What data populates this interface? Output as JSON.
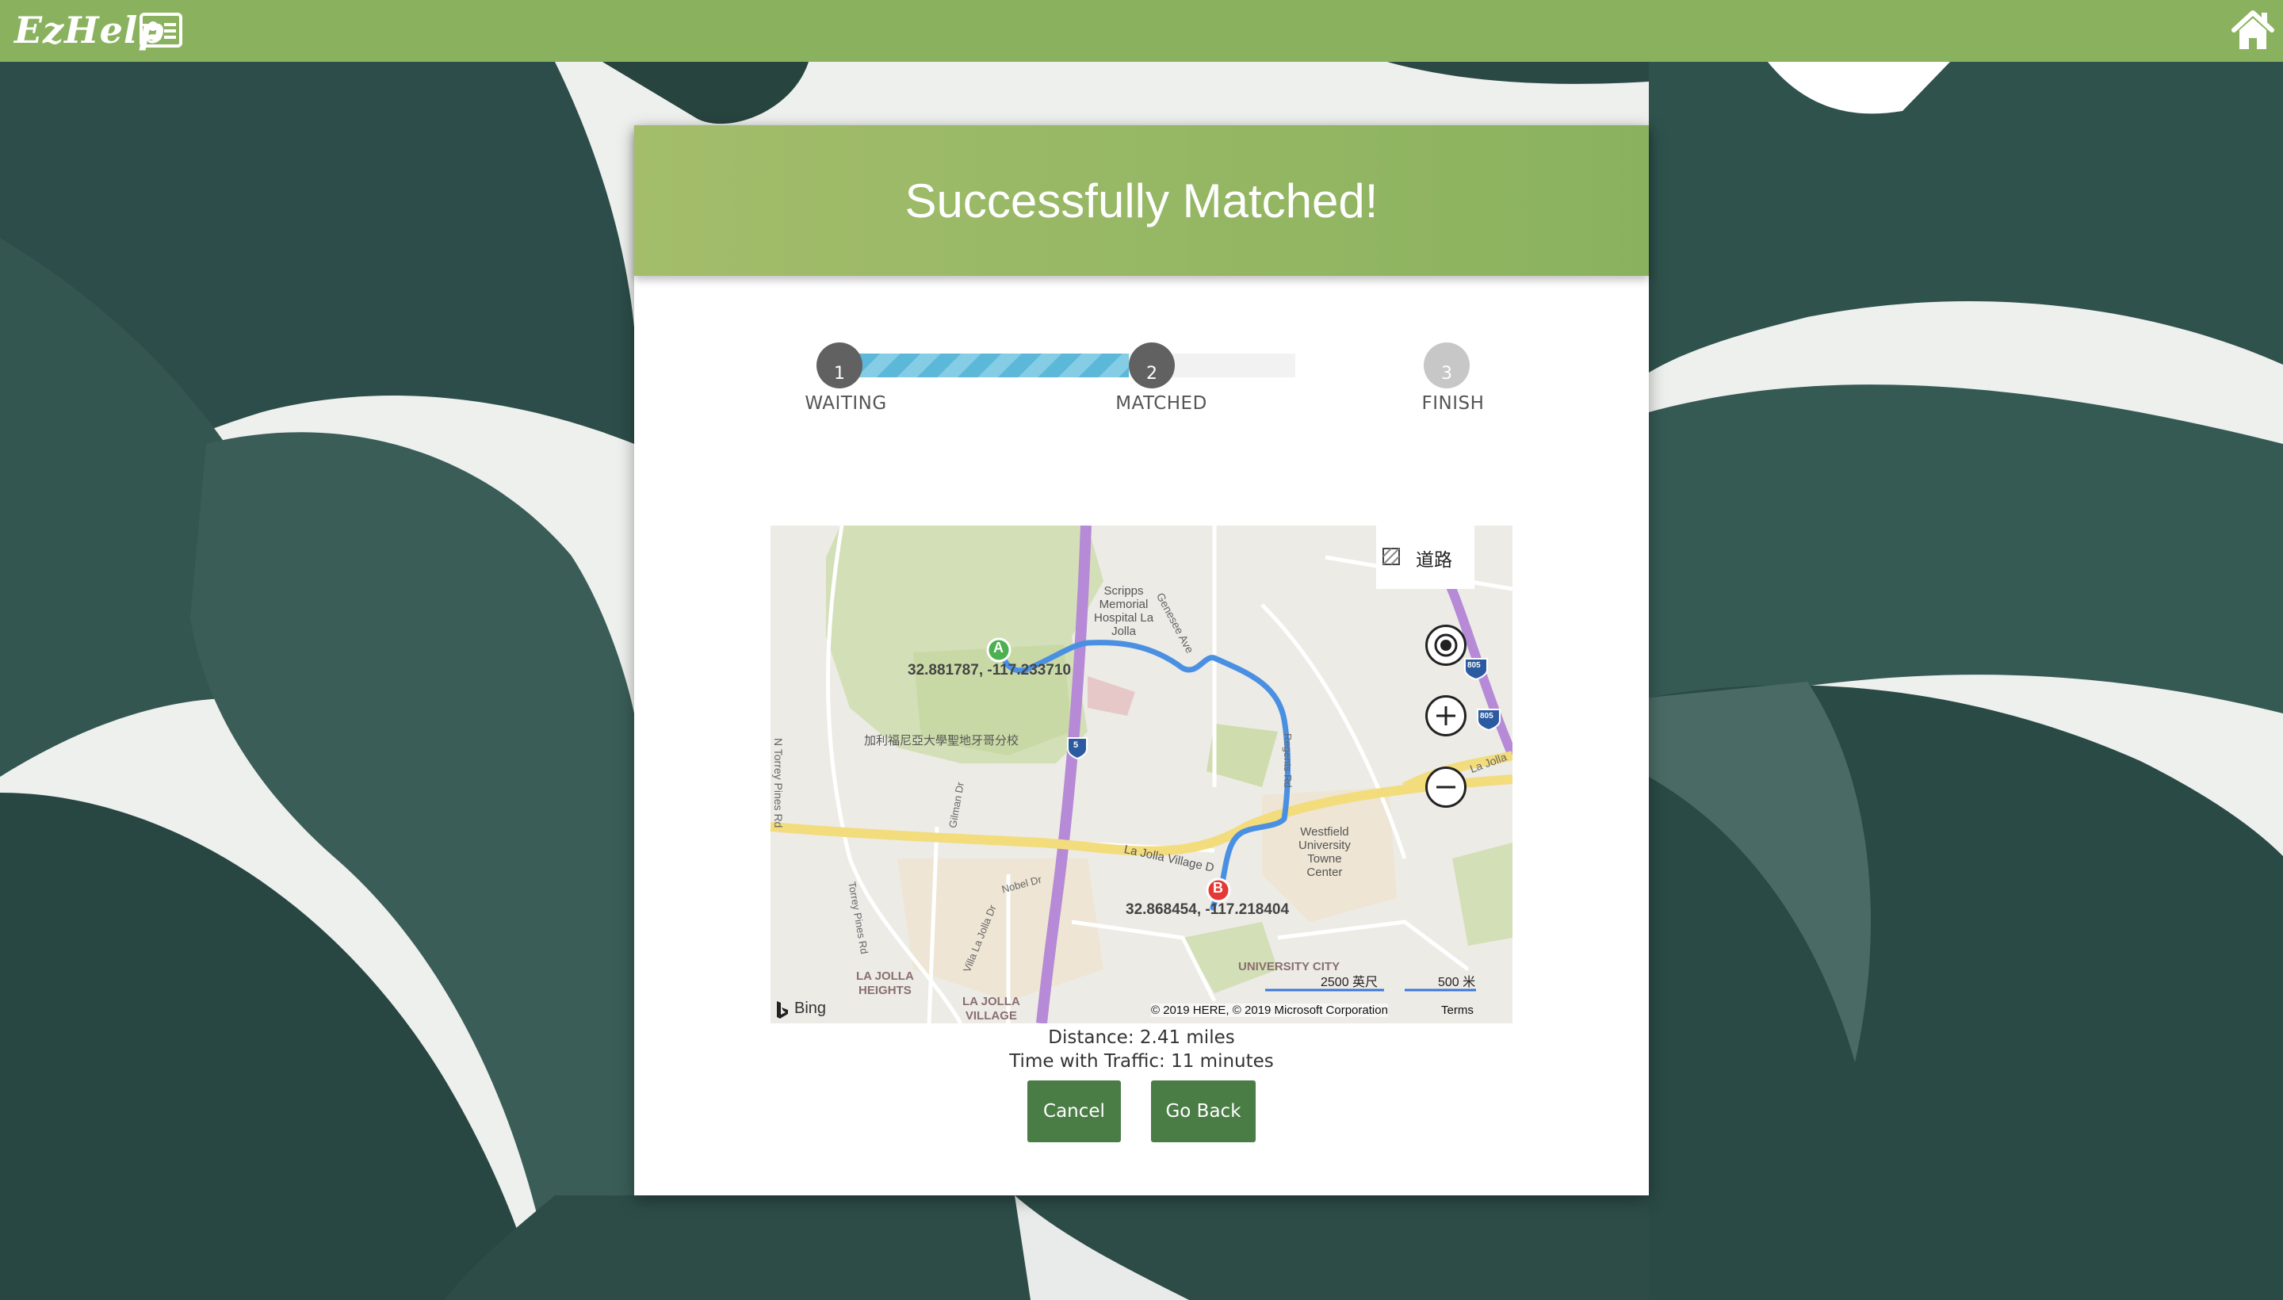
{
  "app": {
    "name": "EzHelp"
  },
  "header": {
    "title": "Successfully Matched!"
  },
  "progress": {
    "fraction": 0.5,
    "steps": [
      {
        "number": "1",
        "label": "WAITING",
        "state": "done"
      },
      {
        "number": "2",
        "label": "MATCHED",
        "state": "current"
      },
      {
        "number": "3",
        "label": "FINISH",
        "state": "pending"
      }
    ]
  },
  "map": {
    "style_label": "道路",
    "origin": {
      "marker": "A",
      "coords": "32.881787, -117.233710"
    },
    "destination": {
      "marker": "B",
      "coords": "32.868454, -117.218404"
    },
    "labels": {
      "hospital": [
        "Scripps",
        "Memorial",
        "Hospital La",
        "Jolla"
      ],
      "campus": "加利福尼亞大學聖地牙哥分校",
      "torrey": "N Torrey Pines Rd",
      "genesee": "Genesee Ave",
      "regents": "Regents Rd",
      "lajolla_village": "La Jolla Village D",
      "westfield": [
        "Westfield",
        "University",
        "Towne",
        "Center"
      ],
      "gilman": "Gilman Dr",
      "nobel": "Nobel Dr",
      "villa": "Villa La Jolla Dr",
      "torrey2": "Torrey Pines Rd",
      "lj_heights": [
        "LA JOLLA",
        "HEIGHTS"
      ],
      "lj_village": [
        "LA JOLLA",
        "VILLAGE"
      ],
      "university_city": "UNIVERSITY CITY",
      "lajolla_right": "La Jolla",
      "i5": "5",
      "i805a": "805",
      "i805b": "805"
    },
    "scale_feet": "2500 英尺",
    "scale_meters": "500 米",
    "brand": "Bing",
    "copyright": "© 2019 HERE, © 2019 Microsoft Corporation",
    "terms": "Terms"
  },
  "trip": {
    "distance": "Distance: 2.41 miles",
    "time": "Time with Traffic: 11 minutes"
  },
  "buttons": {
    "cancel": "Cancel",
    "go_back": "Go Back"
  },
  "colors": {
    "topbar": "#8ab25e",
    "header_left": "#a3bd6b",
    "button": "#4a7d45",
    "route": "#4a90e2",
    "progress": "#5cb8d8"
  },
  "icons": [
    "id-card-icon",
    "home-icon",
    "locate-icon",
    "zoom-in-icon",
    "zoom-out-icon",
    "map-style-icon",
    "bing-logo-icon"
  ]
}
